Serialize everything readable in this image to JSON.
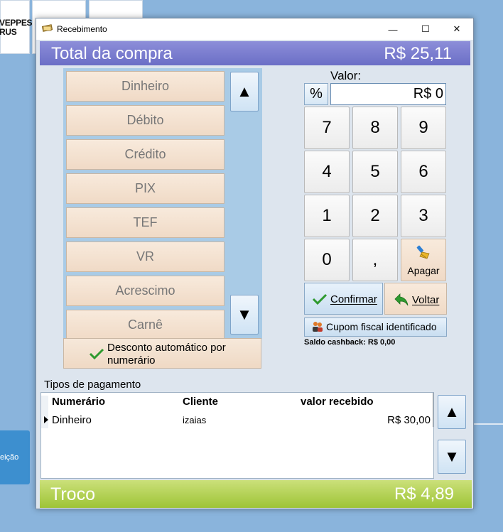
{
  "background": {
    "tile_text": "VEPPES S\nRUS",
    "side_button_label": "eição"
  },
  "window": {
    "title": "Recebimento",
    "controls": {
      "minimize": "—",
      "maximize": "☐",
      "close": "✕"
    }
  },
  "total": {
    "label": "Total da compra",
    "value": "R$ 25,11"
  },
  "payment_methods": [
    "Dinheiro",
    "Débito",
    "Crédito",
    "PIX",
    "TEF",
    "VR",
    "Acrescimo",
    "Carnê"
  ],
  "desconto_button": {
    "line1": "Desconto automático por",
    "line2": "numerário"
  },
  "valor": {
    "label": "Valor:",
    "value": "R$ 0",
    "percent_label": "%"
  },
  "keypad": [
    "7",
    "8",
    "9",
    "4",
    "5",
    "6",
    "1",
    "2",
    "3",
    "0",
    ","
  ],
  "apagar_label": "Apagar",
  "actions": {
    "confirmar": "Confirmar",
    "voltar": "Voltar",
    "cupom": "Cupom fiscal identificado"
  },
  "cashback": "Saldo cashback: R$ 0,00",
  "payments_table": {
    "label": "Tipos de pagamento",
    "columns": [
      "Numerário",
      "Cliente",
      "valor recebido"
    ],
    "rows": [
      {
        "numerario": "Dinheiro",
        "cliente": "izaias",
        "valor": "R$ 30,00"
      }
    ]
  },
  "troco": {
    "label": "Troco",
    "value": "R$ 4,89"
  },
  "scroll_arrows": {
    "up": "▲",
    "down": "▼"
  },
  "colors": {
    "total_bar": "#7b7ed0",
    "troco_bar": "#b4d256",
    "method_button": "#f4e2d0",
    "accent_blue": "#c8ddf0"
  }
}
